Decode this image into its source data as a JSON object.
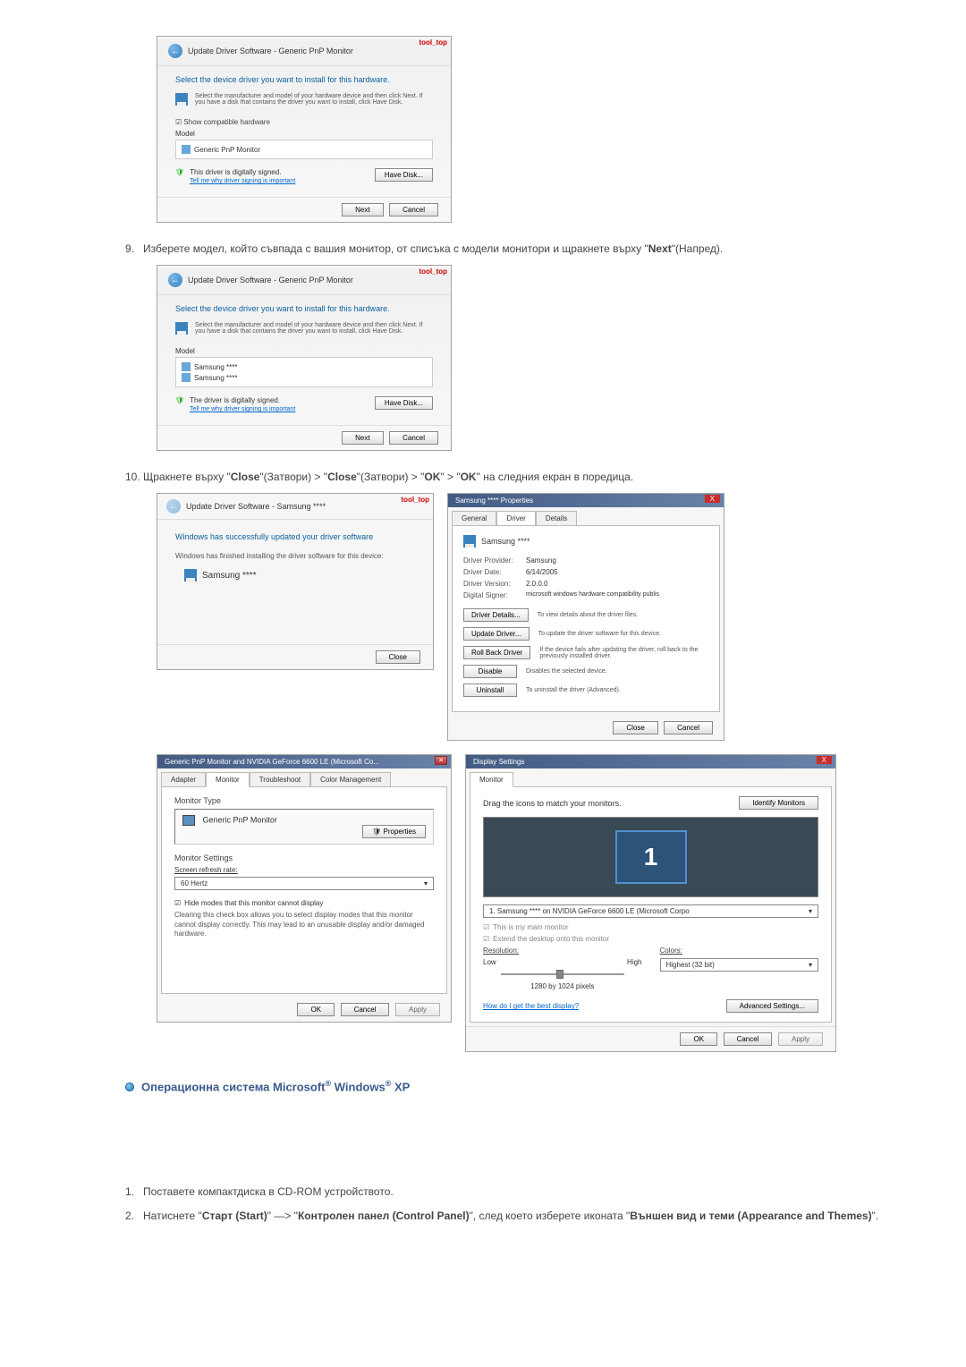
{
  "dialog1": {
    "red_label": "tool_top",
    "breadcrumb": "Update Driver Software - Generic PnP Monitor",
    "prompt": "Select the device driver you want to install for this hardware.",
    "info": "Select the manufacturer and model of your hardware device and then click Next. If you have a disk that contains the driver you want to install, click Have Disk.",
    "checkbox": "Show compatible hardware",
    "model_label": "Model",
    "model_item": "Generic PnP Monitor",
    "signed": "This driver is digitally signed.",
    "signed_link": "Tell me why driver signing is important",
    "have_disk_btn": "Have Disk...",
    "next_btn": "Next",
    "cancel_btn": "Cancel"
  },
  "step9": {
    "num": "9.",
    "text_a": "Изберете модел, който съвпада с вашия монитор, от списъка с модели монитори и щракнете върху \"",
    "next": "Next",
    "text_b": "\"(Напред)."
  },
  "dialog2": {
    "red_label": "tool_top",
    "breadcrumb": "Update Driver Software - Generic PnP Monitor",
    "prompt": "Select the device driver you want to install for this hardware.",
    "info": "Select the manufacturer and model of your hardware device and then click Next. If you have a disk that contains the driver you want to install, click Have Disk.",
    "model_label": "Model",
    "model_item1": "Samsung ****",
    "model_item2": "Samsung ****",
    "signed": "The driver is digitally signed.",
    "signed_link": "Tell me why driver signing is important",
    "have_disk_btn": "Have Disk...",
    "next_btn": "Next",
    "cancel_btn": "Cancel"
  },
  "step10": {
    "num": "10.",
    "text_a": "Щракнете върху \"",
    "close1": "Close",
    "text_b": "\"(Затвори) > \"",
    "close2": "Close",
    "text_c": "\"(Затвори) > \"",
    "ok1": "OK",
    "text_d": "\" > \"",
    "ok2": "OK",
    "text_e": "\" на следния екран в поредица."
  },
  "success_dialog": {
    "red_label": "tool_top",
    "breadcrumb": "Update Driver Software - Samsung ****",
    "title": "Windows has successfully updated your driver software",
    "text": "Windows has finished installing the driver software for this device:",
    "monitor": "Samsung ****",
    "close_btn": "Close"
  },
  "props_dialog": {
    "title": "Samsung **** Properties",
    "tab_general": "General",
    "tab_driver": "Driver",
    "tab_details": "Details",
    "monitor": "Samsung ****",
    "provider_label": "Driver Provider:",
    "provider": "Samsung",
    "date_label": "Driver Date:",
    "date": "6/14/2005",
    "version_label": "Driver Version:",
    "version": "2.0.0.0",
    "signer_label": "Digital Signer:",
    "signer": "microsoft windows hardware compatibility publis",
    "details_btn": "Driver Details...",
    "details_desc": "To view details about the driver files.",
    "update_btn": "Update Driver...",
    "update_desc": "To update the driver software for this device.",
    "rollback_btn": "Roll Back Driver",
    "rollback_desc": "If the device fails after updating the driver, roll back to the previously installed driver.",
    "disable_btn": "Disable",
    "disable_desc": "Disables the selected device.",
    "uninstall_btn": "Uninstall",
    "uninstall_desc": "To uninstall the driver (Advanced).",
    "close_btn": "Close",
    "cancel_btn": "Cancel"
  },
  "monitor_props": {
    "title": "Generic PnP Monitor and NVIDIA GeForce 6600 LE (Microsoft Co...",
    "tab_adapter": "Adapter",
    "tab_monitor": "Monitor",
    "tab_troubleshoot": "Troubleshoot",
    "tab_color": "Color Management",
    "type_label": "Monitor Type",
    "monitor_name": "Generic PnP Monitor",
    "props_btn": "Properties",
    "settings_label": "Monitor Settings",
    "refresh_label": "Screen refresh rate:",
    "refresh_value": "60 Hertz",
    "hide_checkbox": "Hide modes that this monitor cannot display",
    "hide_help": "Clearing this check box allows you to select display modes that this monitor cannot display correctly. This may lead to an unusable display and/or damaged hardware.",
    "ok_btn": "OK",
    "cancel_btn": "Cancel",
    "apply_btn": "Apply"
  },
  "display_settings": {
    "title": "Display Settings",
    "tab": "Monitor",
    "drag_text": "Drag the icons to match your monitors.",
    "identify_btn": "Identify Monitors",
    "monitor_num": "1",
    "dropdown": "1. Samsung **** on NVIDIA GeForce 6600 LE (Microsoft Corpo",
    "main_checkbox": "This is my main monitor",
    "extend_checkbox": "Extend the desktop onto this monitor",
    "resolution_label": "Resolution:",
    "res_low": "Low",
    "res_high": "High",
    "res_value": "1280 by 1024 pixels",
    "colors_label": "Colors:",
    "colors_value": "Highest (32 bit)",
    "best_link": "How do I get the best display?",
    "advanced_btn": "Advanced Settings...",
    "ok_btn": "OK",
    "cancel_btn": "Cancel",
    "apply_btn": "Apply"
  },
  "os_heading": {
    "text_a": "Операционна система Microsoft",
    "reg1": "®",
    "text_b": " Windows",
    "reg2": "®",
    "text_c": " XP"
  },
  "step_xp1": {
    "num": "1.",
    "text": "Поставете компактдиска в CD-ROM устройството."
  },
  "step_xp2": {
    "num": "2.",
    "text_a": "Натиснете \"",
    "start": "Старт (Start)",
    "text_b": "\" —> \"",
    "cp": "Контролен панел (Control Panel)",
    "text_c": "\", след което изберете иконата \"",
    "app": "Външен вид и теми (Appearance and Themes)",
    "text_d": "\"."
  }
}
